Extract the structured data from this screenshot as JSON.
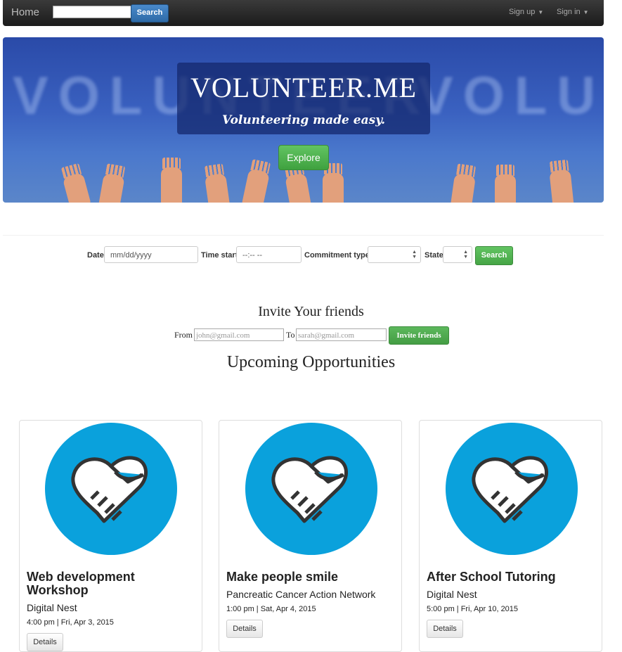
{
  "navbar": {
    "home": "Home",
    "search_placeholder": "",
    "search_button": "Search",
    "signup": "Sign up",
    "signin": "Sign in"
  },
  "hero": {
    "title": "VOLUNTEER.ME",
    "tagline": "Volunteering made easy.",
    "background_text": "VOLUNTEER",
    "explore_button": "Explore"
  },
  "filters": {
    "date_label": "Date",
    "date_placeholder": "mm/dd/yyyy",
    "time_label": "Time start",
    "time_placeholder": "--:-- --",
    "commitment_label": "Commitment type",
    "commitment_value": "",
    "state_label": "State",
    "state_value": "",
    "search_button": "Search"
  },
  "invite": {
    "title": "Invite Your friends",
    "from_label": "From",
    "from_placeholder": "john@gmail.com",
    "to_label": "To",
    "to_placeholder": "sarah@gmail.com",
    "button": "Invite friends"
  },
  "upcoming": {
    "title": "Upcoming Opportunities",
    "cards": [
      {
        "title": "Web development Workshop",
        "org": "Digital Nest",
        "time": "4:00 pm | Fri, Apr 3, 2015",
        "button": "Details",
        "icon": "handshake-heart-icon"
      },
      {
        "title": "Make people smile",
        "org": "Pancreatic Cancer Action Network",
        "time": "1:00 pm | Sat, Apr 4, 2015",
        "button": "Details",
        "icon": "handshake-heart-icon"
      },
      {
        "title": "After School Tutoring",
        "org": "Digital Nest",
        "time": "5:00 pm | Fri, Apr 10, 2015",
        "button": "Details",
        "icon": "handshake-heart-icon"
      }
    ]
  },
  "colors": {
    "navbar": "#222222",
    "hero_blue": "#3a61c0",
    "green": "#5cb85c",
    "card_circle": "#0aa1dc"
  }
}
